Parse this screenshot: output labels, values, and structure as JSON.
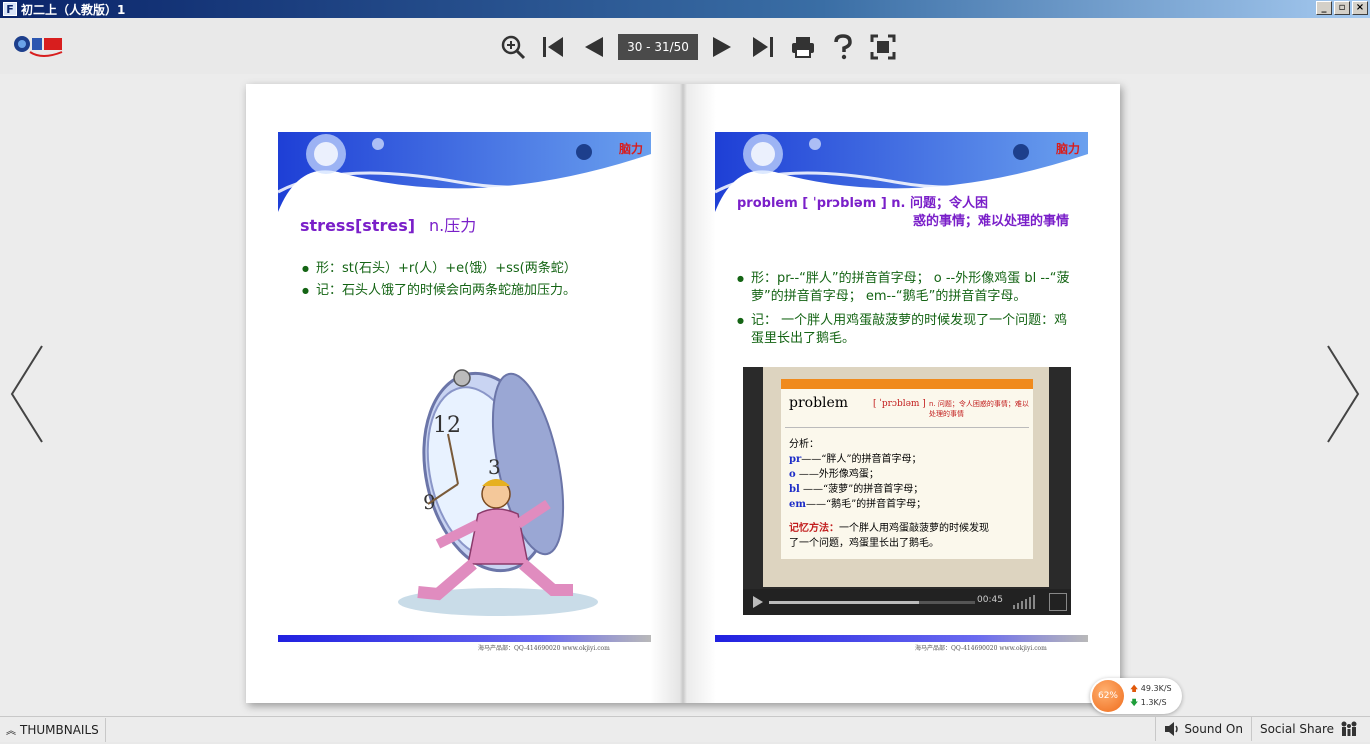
{
  "window": {
    "title": "初二上（人教版）1",
    "app_icon": "F",
    "controls": [
      "_",
      "▫",
      "×"
    ]
  },
  "toolbar": {
    "logo_icon": "brand-logo-icon",
    "page_indicator": "30 - 31/50",
    "icons": [
      "zoom-in-icon",
      "first-page-icon",
      "prev-page-icon",
      "next-page-icon",
      "last-page-icon",
      "print-icon",
      "help-icon",
      "fullscreen-icon"
    ]
  },
  "left_page": {
    "corner_logo": "脑力",
    "heading_word": "stress[stres]",
    "heading_meaning": "n.压力",
    "bullets": [
      "形：st(石头）+r(人）+e(饿）+ss(两条蛇）",
      "记：石头人饿了的时候会向两条蛇施加压力。"
    ],
    "footer": "海马产品部：QQ-414690020        www.okjiyi.com"
  },
  "right_page": {
    "corner_logo": "脑力",
    "heading_word": "problem [ ˈprɔbləm ]",
    "heading_meaning_1": "n. 问题；令人困",
    "heading_meaning_2": "惑的事情；难以处理的事情",
    "bullets": [
      "形：pr--“胖人”的拼音首字母； o --外形像鸡蛋 bl --“菠萝”的拼音首字母；  em--“鹅毛”的拼音首字母。",
      "记： 一个胖人用鸡蛋敲菠萝的时候发现了一个问题：鸡蛋里长出了鹅毛。"
    ],
    "footer": "海马产品部：QQ-414690020        www.okjiyi.com",
    "video": {
      "word": "problem",
      "phonetic": "[ ˈprɔbləm ]",
      "meaning": "n. 问题；令人困惑的事情；难以处理的事情",
      "analysis_title": "分析：",
      "analysis": [
        {
          "k": "pr",
          "v": "——“胖人”的拼音首字母；"
        },
        {
          "k": "o",
          "v": " ——外形像鸡蛋；"
        },
        {
          "k": "bl",
          "v": " ——“菠萝”的拼音首字母；"
        },
        {
          "k": "em",
          "v": "——“鹅毛”的拼音首字母；"
        }
      ],
      "memory_label": "记忆方法：",
      "memory_text": "一个胖人用鸡蛋敲菠萝的时候发现了一个问题，鸡蛋里长出了鹅毛。",
      "time": "00:45",
      "progress": 0.73
    }
  },
  "speed": {
    "percent": "62%",
    "up": "49.3K/S",
    "down": "1.3K/S"
  },
  "bottom": {
    "thumbnails": "THUMBNAILS",
    "sound": "Sound On",
    "social": "Social Share"
  }
}
